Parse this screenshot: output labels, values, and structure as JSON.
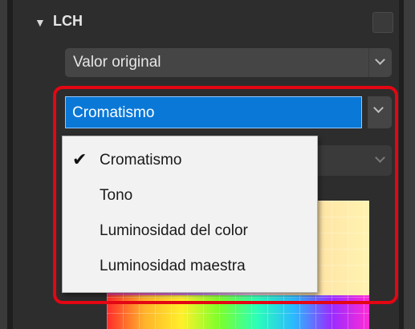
{
  "section": {
    "title": "LCH"
  },
  "mode_dropdown": {
    "value": "Valor original"
  },
  "channel_dropdown": {
    "value": "Cromatismo"
  },
  "channel_menu": {
    "items": [
      {
        "label": "Cromatismo",
        "checked": true
      },
      {
        "label": "Tono",
        "checked": false
      },
      {
        "label": "Luminosidad del color",
        "checked": false
      },
      {
        "label": "Luminosidad maestra",
        "checked": false
      }
    ],
    "check_glyph": "✔"
  },
  "colors": {
    "selection": "#0a78d7",
    "highlight_frame": "#e30613"
  },
  "icons": {
    "collapse": "triangle-down-icon",
    "dropdown": "chevron-down-icon",
    "checkmark": "checkmark-icon"
  }
}
